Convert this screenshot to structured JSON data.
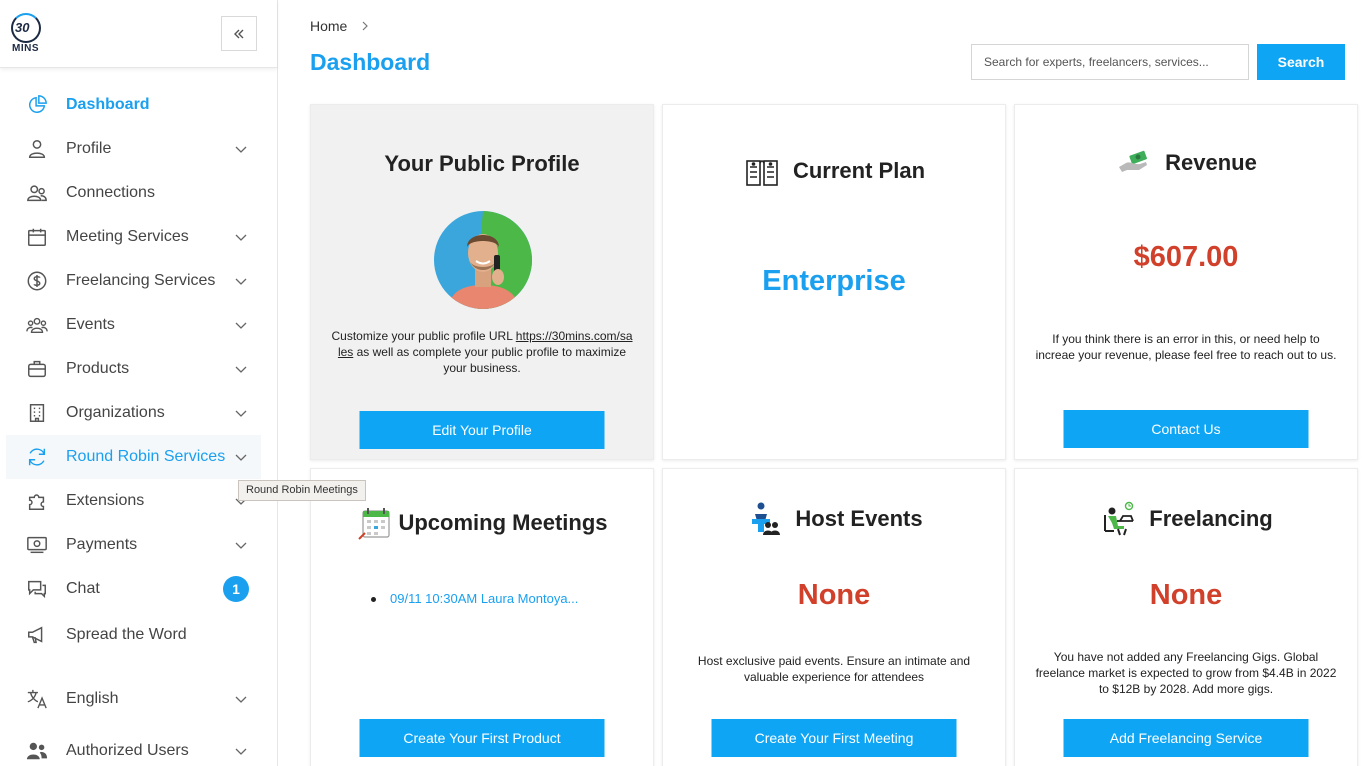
{
  "logo": {
    "number": "30",
    "word": "MINS"
  },
  "sidebar": {
    "items": [
      {
        "label": "Dashboard"
      },
      {
        "label": "Profile"
      },
      {
        "label": "Connections"
      },
      {
        "label": "Meeting Services"
      },
      {
        "label": "Freelancing Services"
      },
      {
        "label": "Events"
      },
      {
        "label": "Products"
      },
      {
        "label": "Organizations"
      },
      {
        "label": "Round Robin Services"
      },
      {
        "label": "Extensions"
      },
      {
        "label": "Payments"
      },
      {
        "label": "Chat",
        "badge": "1"
      },
      {
        "label": "Spread the Word"
      },
      {
        "label": "English"
      },
      {
        "label": "Authorized Users"
      }
    ],
    "tooltip": "Round Robin Meetings"
  },
  "header": {
    "breadcrumb": "Home",
    "title": "Dashboard",
    "search_placeholder": "Search for experts, freelancers, services...",
    "search_label": "Search"
  },
  "cards": {
    "profile": {
      "title": "Your Public Profile",
      "text_before": "Customize your public profile URL ",
      "link": "https://30mins.com/sales",
      "text_after": " as well as complete your public profile to maximize your business.",
      "button": "Edit Your Profile"
    },
    "plan": {
      "title": "Current Plan",
      "value": "Enterprise"
    },
    "revenue": {
      "title": "Revenue",
      "value": "$607.00",
      "text": "If you think there is an error in this, or need help to increae your revenue, please feel free to reach out to us.",
      "button": "Contact Us"
    },
    "meetings": {
      "title": "Upcoming Meetings",
      "items": [
        "09/11 10:30AM Laura Montoya..."
      ],
      "button": "Create Your First Product"
    },
    "events": {
      "title": "Host Events",
      "value": "None",
      "text": "Host exclusive paid events. Ensure an intimate and valuable experience for attendees",
      "button": "Create Your First Meeting"
    },
    "freelancing": {
      "title": "Freelancing",
      "value": "None",
      "text": "You have not added any Freelancing Gigs. Global freelance market is expected to grow from $4.4B in 2022 to $12B by 2028. Add more gigs.",
      "button": "Add Freelancing Service"
    }
  },
  "colors": {
    "accent": "#1aa0ef",
    "button": "#0ea5f5",
    "value_red": "#d0402a"
  }
}
